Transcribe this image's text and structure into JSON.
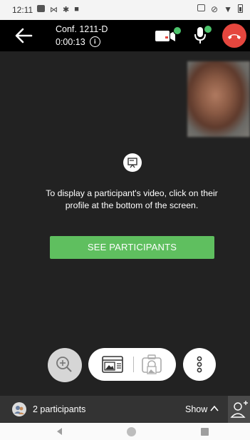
{
  "status_bar": {
    "time": "12:11"
  },
  "call": {
    "conference_title": "Conf. 1211-D",
    "duration": "0:00:13"
  },
  "main": {
    "hint": "To display a participant's video, click on their profile at the bottom of the screen.",
    "see_participants_label": "SEE PARTICIPANTS"
  },
  "participants_bar": {
    "count_label": "2 participants",
    "show_label": "Show"
  },
  "colors": {
    "accent_green": "#5fbf5f",
    "hangup_red": "#e5463e",
    "status_check": "#4cc36b"
  },
  "icons": {
    "back": "arrow-left-icon",
    "info": "info-icon",
    "camera": "camera-icon",
    "mic": "microphone-icon",
    "hangup": "phone-hangup-icon",
    "board": "presentation-board-icon",
    "zoom": "zoom-in-icon",
    "layout": "gallery-layout-icon",
    "snapshot": "camera-snapshot-icon",
    "more": "more-vertical-icon",
    "participants": "participants-avatar-icon",
    "chevron": "chevron-up-icon",
    "add_person": "add-person-icon"
  }
}
